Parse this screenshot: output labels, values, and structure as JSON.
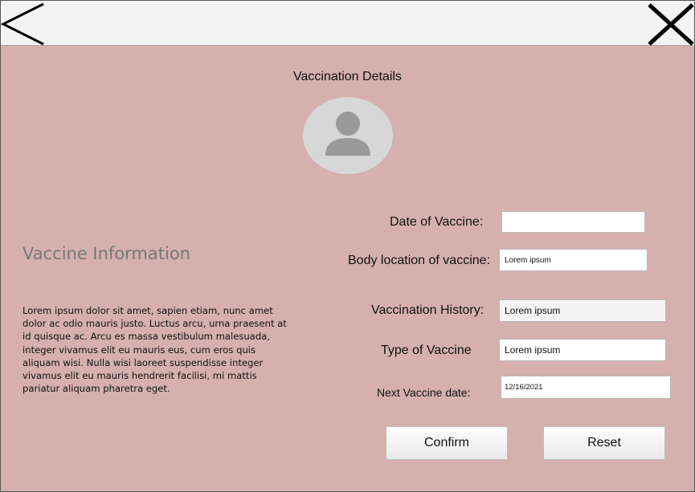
{
  "header": {
    "back_icon": "chevron-left-icon",
    "close_icon": "close-icon"
  },
  "page_title": "Vaccination Details",
  "avatar_icon": "user-placeholder-icon",
  "info": {
    "heading": "Vaccine Information",
    "body": "Lorem ipsum dolor sit amet, sapien etiam, nunc amet dolor ac odio mauris justo. Luctus arcu, urna praesent at id quisque ac. Arcu es massa vestibulum malesuada, integer vivamus elit eu mauris eus, cum eros quis aliquam wisi. Nulla wisi laoreet suspendisse integer vivamus elit eu mauris hendrerit facilisi, mi mattis pariatur aliquam pharetra eget."
  },
  "form": {
    "date_of_vaccine": {
      "label": "Date of Vaccine:",
      "value": ""
    },
    "body_location": {
      "label": "Body location of vaccine:",
      "value": "Lorem ipsum"
    },
    "history": {
      "label": "Vaccination History:",
      "value": "Lorem ipsum"
    },
    "type": {
      "label": "Type of Vaccine",
      "value": "Lorem ipsum"
    },
    "next_date": {
      "label": "Next Vaccine date:",
      "value": "12/16/2021"
    }
  },
  "buttons": {
    "confirm": "Confirm",
    "reset": "Reset"
  },
  "colors": {
    "background": "#d5b0ae",
    "topbar": "#f3f3f3",
    "avatar": "#d7d7d7"
  }
}
